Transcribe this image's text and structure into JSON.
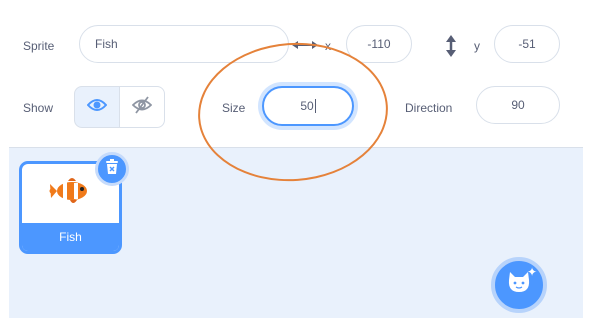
{
  "sprite_info": {
    "sprite_label": "Sprite",
    "sprite_name": "Fish",
    "x_label": "x",
    "x_value": "-110",
    "y_label": "y",
    "y_value": "-51",
    "show_label": "Show",
    "size_label": "Size",
    "size_value": "50",
    "direction_label": "Direction",
    "direction_value": "90"
  },
  "sprite_list": {
    "items": [
      {
        "name": "Fish",
        "selected": true
      }
    ]
  },
  "colors": {
    "accent": "#4c97ff",
    "annotation": "#e5823a",
    "pane_background": "#e9f1fc"
  },
  "icons": [
    "x-arrows-icon",
    "y-arrows-icon",
    "eye-icon",
    "eye-slash-icon",
    "trash-icon",
    "choose-sprite-cat-icon"
  ]
}
